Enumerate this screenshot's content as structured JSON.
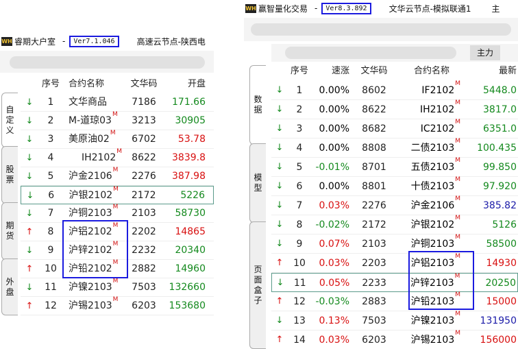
{
  "left_window": {
    "app_title": "睿期大户室",
    "logo_text": "WH",
    "version": "Ver7.1.046",
    "server": "高速云节点-陕西电",
    "side_tabs": [
      "自定义",
      "股票",
      "期货",
      "外盘"
    ],
    "headers": [
      "序号",
      "合约名称",
      "文华码",
      "开盘"
    ],
    "rows": [
      {
        "dir": "down",
        "seq": "1",
        "name": "文华商品",
        "m": false,
        "code": "7186",
        "open": "171.66",
        "color": "dn"
      },
      {
        "dir": "down",
        "seq": "2",
        "name": "M-道琼03",
        "m": true,
        "code": "3213",
        "open": "30905",
        "color": "dn"
      },
      {
        "dir": "down",
        "seq": "3",
        "name": "美原油02",
        "m": true,
        "code": "6702",
        "open": "53.78",
        "color": "up"
      },
      {
        "dir": "down",
        "seq": "4",
        "name": "IH2102",
        "m": true,
        "code": "8622",
        "open": "3839.8",
        "color": "up"
      },
      {
        "dir": "down",
        "seq": "5",
        "name": "沪金2106",
        "m": true,
        "code": "2276",
        "open": "387.98",
        "color": "up"
      },
      {
        "dir": "down",
        "seq": "6",
        "name": "沪银2102",
        "m": true,
        "code": "2172",
        "open": "5226",
        "color": "dn"
      },
      {
        "dir": "down",
        "seq": "7",
        "name": "沪铜2103",
        "m": true,
        "code": "2103",
        "open": "58730",
        "color": "dn"
      },
      {
        "dir": "up",
        "seq": "8",
        "name": "沪铝2102",
        "m": true,
        "code": "2202",
        "open": "14865",
        "color": "up"
      },
      {
        "dir": "down",
        "seq": "9",
        "name": "沪锌2102",
        "m": true,
        "code": "2232",
        "open": "20340",
        "color": "dn"
      },
      {
        "dir": "up",
        "seq": "10",
        "name": "沪铅2102",
        "m": true,
        "code": "2882",
        "open": "14960",
        "color": "dn"
      },
      {
        "dir": "down",
        "seq": "11",
        "name": "沪镍2103",
        "m": true,
        "code": "7503",
        "open": "132660",
        "color": "dn"
      },
      {
        "dir": "up",
        "seq": "12",
        "name": "沪锡2103",
        "m": true,
        "code": "6203",
        "open": "153680",
        "color": "dn"
      }
    ]
  },
  "right_window": {
    "app_title": "赢智量化交易",
    "logo_text": "WH",
    "version": "Ver8.3.892",
    "server": "文华云节点-模拟联通1",
    "menu_cut": "主",
    "zhuli_tab": "主力",
    "side_tabs": [
      "数据",
      "模型",
      "页面盒子"
    ],
    "headers": [
      "序号",
      "速涨",
      "文华码",
      "合约名称",
      "最新"
    ],
    "rows": [
      {
        "dir": "down",
        "seq": "1",
        "speed": "0.00%",
        "sc": "",
        "code": "8602",
        "name": "IF2102",
        "m": true,
        "last": "5448.0",
        "lc": "dn"
      },
      {
        "dir": "down",
        "seq": "2",
        "speed": "0.00%",
        "sc": "",
        "code": "8622",
        "name": "IH2102",
        "m": true,
        "last": "3817.0",
        "lc": "dn"
      },
      {
        "dir": "down",
        "seq": "3",
        "speed": "0.00%",
        "sc": "",
        "code": "8682",
        "name": "IC2102",
        "m": true,
        "last": "6351.0",
        "lc": "dn"
      },
      {
        "dir": "down",
        "seq": "4",
        "speed": "0.00%",
        "sc": "",
        "code": "8808",
        "name": "二债2103",
        "m": true,
        "last": "100.435",
        "lc": "dn"
      },
      {
        "dir": "down",
        "seq": "5",
        "speed": "-0.01%",
        "sc": "dn",
        "code": "8701",
        "name": "五债2103",
        "m": true,
        "last": "99.850",
        "lc": "dn"
      },
      {
        "dir": "down",
        "seq": "6",
        "speed": "0.00%",
        "sc": "",
        "code": "8801",
        "name": "十债2103",
        "m": true,
        "last": "97.920",
        "lc": "dn"
      },
      {
        "dir": "down",
        "seq": "7",
        "speed": "0.03%",
        "sc": "up",
        "code": "2276",
        "name": "沪金2106",
        "m": true,
        "last": "385.82",
        "lc": "blue"
      },
      {
        "dir": "down",
        "seq": "8",
        "speed": "-0.02%",
        "sc": "dn",
        "code": "2172",
        "name": "沪银2102",
        "m": true,
        "last": "5126",
        "lc": "dn"
      },
      {
        "dir": "down",
        "seq": "9",
        "speed": "0.07%",
        "sc": "up",
        "code": "2103",
        "name": "沪铜2103",
        "m": true,
        "last": "58500",
        "lc": "dn"
      },
      {
        "dir": "up",
        "seq": "10",
        "speed": "0.03%",
        "sc": "up",
        "code": "2203",
        "name": "沪铝2103",
        "m": true,
        "last": "14930",
        "lc": "up"
      },
      {
        "dir": "down",
        "seq": "11",
        "speed": "0.05%",
        "sc": "up",
        "code": "2233",
        "name": "沪锌2103",
        "m": true,
        "last": "20250",
        "lc": "dn"
      },
      {
        "dir": "up",
        "seq": "12",
        "speed": "-0.03%",
        "sc": "dn",
        "code": "2883",
        "name": "沪铅2103",
        "m": true,
        "last": "15000",
        "lc": "up"
      },
      {
        "dir": "down",
        "seq": "13",
        "speed": "0.13%",
        "sc": "up",
        "code": "7503",
        "name": "沪镍2103",
        "m": true,
        "last": "131950",
        "lc": "blue"
      },
      {
        "dir": "up",
        "seq": "14",
        "speed": "0.03%",
        "sc": "up",
        "code": "6203",
        "name": "沪锡2103",
        "m": true,
        "last": "156000",
        "lc": "up"
      }
    ]
  },
  "colors": {
    "up": "#d80f0f",
    "down": "#13891d",
    "highlight": "#1a1adf"
  }
}
